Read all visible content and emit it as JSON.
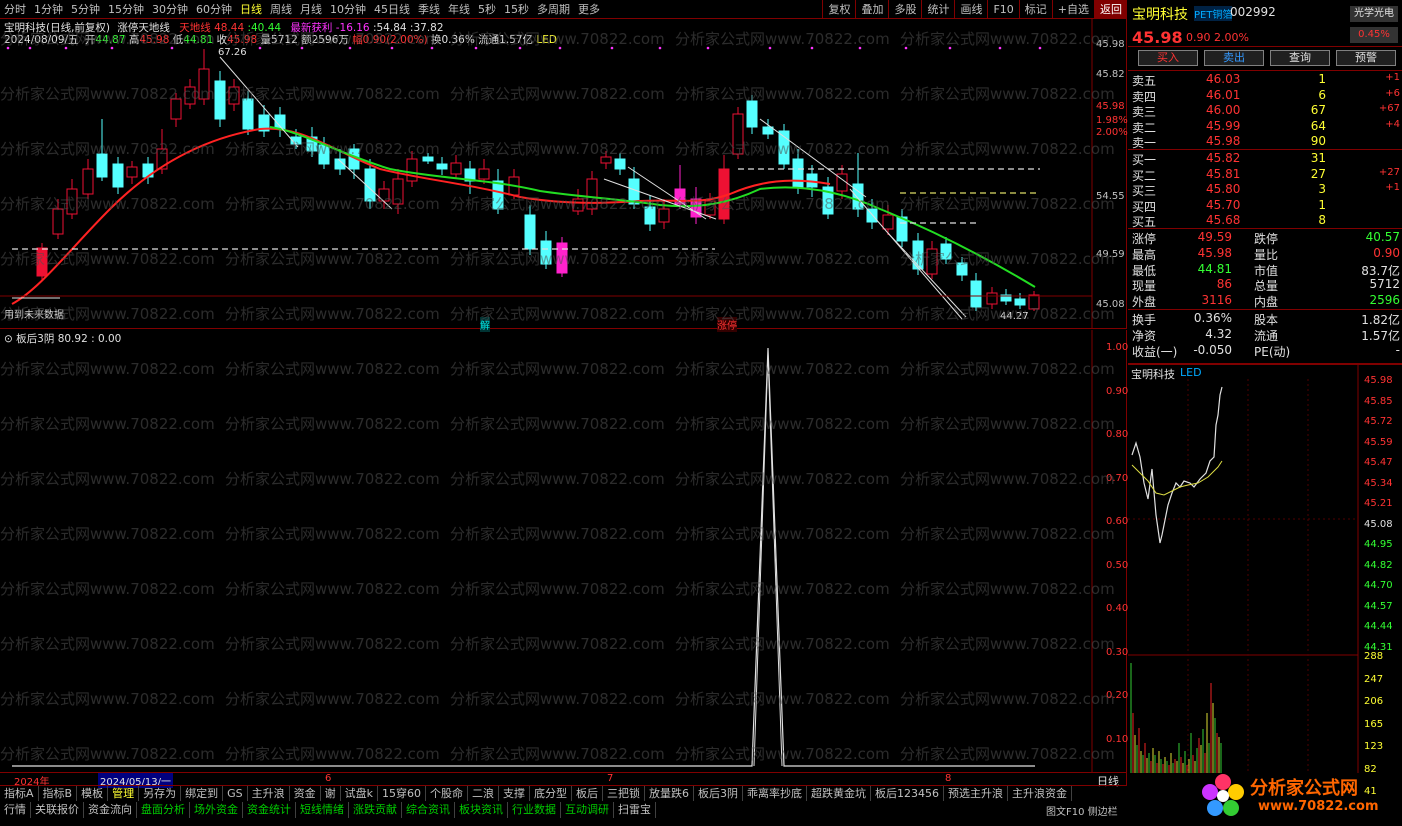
{
  "toolbar": {
    "periods": [
      "分时",
      "1分钟",
      "5分钟",
      "15分钟",
      "30分钟",
      "60分钟",
      "日线",
      "周线",
      "月线",
      "10分钟",
      "45日线",
      "季线",
      "年线",
      "5秒",
      "15秒",
      "多周期",
      "更多"
    ],
    "active_period": "日线",
    "tools": [
      "复权",
      "叠加",
      "多股",
      "统计",
      "画线",
      "F10",
      "标记",
      "+自选",
      "返回"
    ],
    "active_tool": "返回"
  },
  "kline_header": {
    "title": "宝明科技(日线,前复权)",
    "indicator_name": "涨停天地线",
    "tian_label": "天地线",
    "tian_value": "48.44",
    "tian_value2": ":40.44",
    "profit_label": "最新获利",
    "profit_value": "-16.16",
    "val1": ":54.84",
    "val2": ":37.82",
    "date": "2024/08/09/五",
    "open_label": "开",
    "open": "44.87",
    "high_label": "高",
    "high": "45.98",
    "low_label": "低",
    "low": "44.81",
    "close_label": "收",
    "close": "45.98",
    "vol": "量5712",
    "amount": "额2596万",
    "change": "幅0.90(2.00%)",
    "turnover": "换0.36%",
    "float": "流通1.57亿",
    "tag": "LED"
  },
  "kline_axis": [
    "45.98",
    "45.82",
    "45.98",
    "1.98%",
    "2.00%",
    "54.55",
    "49.59",
    "45.08"
  ],
  "kline_annotations": {
    "high_mark": "67.26",
    "low_mark": "44.27",
    "future_note": "用到未来数据",
    "mark_jie": "解",
    "mark_zhangting": "涨停"
  },
  "indicator_header": {
    "name": "板后3阴",
    "value": "80.92",
    "value2": "0.00"
  },
  "indicator_axis": [
    "1.00",
    "0.90",
    "0.80",
    "0.70",
    "0.60",
    "0.50",
    "0.40",
    "0.30",
    "0.20",
    "0.10"
  ],
  "date_axis": {
    "year": "2024年",
    "cursor_date": "2024/05/13/一",
    "months": [
      "6",
      "7",
      "8"
    ],
    "period_button": "日线"
  },
  "quote": {
    "name": "宝明科技",
    "sector": "PET铜箔",
    "code": "002992",
    "tag": "光学光电",
    "price": "45.98",
    "change": "0.90",
    "change_pct": "2.00%",
    "tag_pct": "0.45%",
    "buttons": [
      "买入",
      "卖出",
      "查询",
      "预警"
    ],
    "asks": [
      {
        "label": "卖五",
        "price": "46.03",
        "vol": "1",
        "delta": "+1"
      },
      {
        "label": "卖四",
        "price": "46.01",
        "vol": "6",
        "delta": "+6"
      },
      {
        "label": "卖三",
        "price": "46.00",
        "vol": "67",
        "delta": "+67"
      },
      {
        "label": "卖二",
        "price": "45.99",
        "vol": "64",
        "delta": "+4"
      },
      {
        "label": "卖一",
        "price": "45.98",
        "vol": "90",
        "delta": ""
      }
    ],
    "bids": [
      {
        "label": "买一",
        "price": "45.82",
        "vol": "31",
        "delta": ""
      },
      {
        "label": "买二",
        "price": "45.81",
        "vol": "27",
        "delta": "+27"
      },
      {
        "label": "买三",
        "price": "45.80",
        "vol": "3",
        "delta": "+1"
      },
      {
        "label": "买四",
        "price": "45.70",
        "vol": "1",
        "delta": ""
      },
      {
        "label": "买五",
        "price": "45.68",
        "vol": "8",
        "delta": ""
      }
    ],
    "stats": [
      {
        "l1": "涨停",
        "v1": "49.59",
        "l2": "跌停",
        "v2": "40.57"
      },
      {
        "l1": "最高",
        "v1": "45.98",
        "l2": "量比",
        "v2": "0.90"
      },
      {
        "l1": "最低",
        "v1": "44.81",
        "l2": "市值",
        "v2": "83.7亿"
      },
      {
        "l1": "现量",
        "v1": "86",
        "l2": "总量",
        "v2": "5712"
      },
      {
        "l1": "外盘",
        "v1": "3116",
        "l2": "内盘",
        "v2": "2596"
      }
    ],
    "stats2": [
      {
        "l1": "换手",
        "v1": "0.36%",
        "l2": "股本",
        "v2": "1.82亿"
      },
      {
        "l1": "净资",
        "v1": "4.32",
        "l2": "流通",
        "v2": "1.57亿"
      },
      {
        "l1": "收益(一)",
        "v1": "-0.050",
        "l2": "PE(动)",
        "v2": "-"
      }
    ]
  },
  "mini_chart": {
    "title": "宝明科技",
    "tag": "LED",
    "price_axis": [
      "45.98",
      "45.85",
      "45.72",
      "45.59",
      "45.47",
      "45.34",
      "45.21",
      "45.08",
      "44.95",
      "44.82",
      "44.70",
      "44.57",
      "44.44",
      "44.31"
    ],
    "vol_axis": [
      "288",
      "247",
      "206",
      "165",
      "123",
      "82",
      "41"
    ]
  },
  "tabs_row1": [
    "指标A",
    "指标B",
    "模板",
    "管理",
    "另存为",
    "绑定到",
    "GS",
    "主升浪",
    "资金",
    "谢",
    "试盘k",
    "15穿60",
    "个股命",
    "二浪",
    "支撑",
    "底分型",
    "板后",
    "三把锁",
    "放量跌6",
    "板后3阴",
    "乖离率抄底",
    "超跌黄金坑",
    "板后123456",
    "预选主升浪",
    "主升浪资金"
  ],
  "tabs_row1_active": "管理",
  "tabs_row2": [
    "行情",
    "关联报价",
    "资金流向",
    "盘面分析",
    "场外资金",
    "资金统计",
    "短线情绪",
    "涨跌贡献",
    "综合资讯",
    "板块资讯",
    "行业数据",
    "互动调研",
    "扫雷宝"
  ],
  "tabs_row2_green": [
    "盘面分析",
    "场外资金",
    "资金统计",
    "短线情绪",
    "涨跌贡献",
    "综合资讯",
    "板块资讯",
    "行业数据",
    "互动调研"
  ],
  "side_button": "图文F10 侧边栏",
  "logo": {
    "name": "分析家公式网",
    "url": "www.70822.com"
  },
  "watermark": "分析家公式网www.70822.com"
}
